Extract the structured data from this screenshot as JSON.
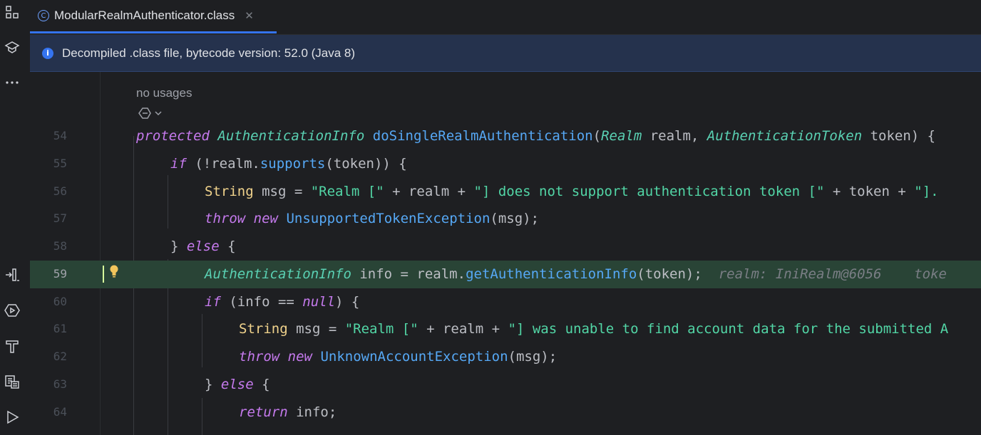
{
  "tab": {
    "label": "ModularRealmAuthenticator.class",
    "close": "✕"
  },
  "banner": {
    "text": "Decompiled .class file, bytecode version: 52.0 (Java 8)"
  },
  "hints": {
    "usages": "no usages"
  },
  "lines": [
    {
      "num": "54"
    },
    {
      "num": "55"
    },
    {
      "num": "56"
    },
    {
      "num": "57"
    },
    {
      "num": "58"
    },
    {
      "num": "59"
    },
    {
      "num": "60"
    },
    {
      "num": "61"
    },
    {
      "num": "62"
    },
    {
      "num": "63"
    },
    {
      "num": "64"
    }
  ],
  "code": {
    "l54": {
      "protected": "protected",
      "type1": "AuthenticationInfo",
      "method": "doSingleRealmAuthentication",
      "p1": "(",
      "t2": "Realm",
      "a1": " realm, ",
      "t3": "AuthenticationToken",
      "a2": " token) {"
    },
    "l55": {
      "if": "if",
      "a": " (!realm.",
      "m": "supports",
      "b": "(token)) {"
    },
    "l56": {
      "t": "String",
      "a": " msg = ",
      "s1": "\"Realm [\"",
      "b": " + realm + ",
      "s2": "\"] does not support authentication token [\"",
      "c": " + token + ",
      "s3": "\"]."
    },
    "l57": {
      "throw": "throw",
      "new": "new",
      "cls": "UnsupportedTokenException",
      "a": "(msg);"
    },
    "l58": {
      "a": "} ",
      "else": "else",
      "b": " {"
    },
    "l59": {
      "t": "AuthenticationInfo",
      "a": " info = realm.",
      "m": "getAuthenticationInfo",
      "b": "(token);",
      "hint": "realm: IniRealm@6056    toke"
    },
    "l60": {
      "if": "if",
      "a": " (info == ",
      "null": "null",
      "b": ") {"
    },
    "l61": {
      "t": "String",
      "a": " msg = ",
      "s1": "\"Realm [\"",
      "b": " + realm + ",
      "s2": "\"] was unable to find account data for the submitted A"
    },
    "l62": {
      "throw": "throw",
      "new": "new",
      "cls": "UnknownAccountException",
      "a": "(msg);"
    },
    "l63": {
      "a": "} ",
      "else": "else",
      "b": " {"
    },
    "l64": {
      "ret": "return",
      "a": " info;"
    }
  },
  "icons": [
    "project-icon",
    "learn-icon",
    "more-icon",
    "debug-step-icon",
    "services-icon",
    "build-icon",
    "database-icon",
    "run-icon"
  ],
  "colors": {
    "accent": "#3574f0",
    "current_line": "#294436",
    "banner_bg": "#25324d",
    "bg": "#1e1f22"
  }
}
